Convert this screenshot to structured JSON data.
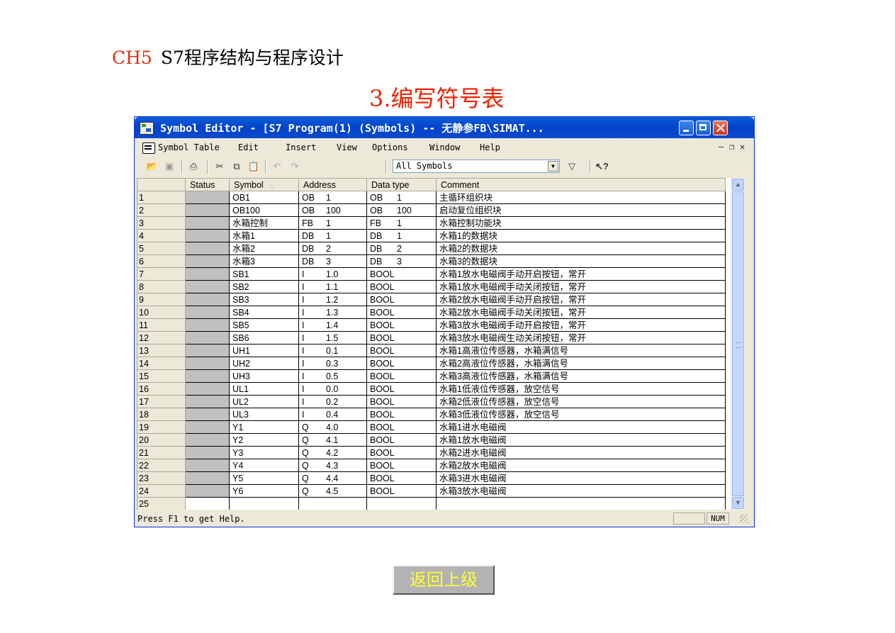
{
  "slide": {
    "chapter": "CH5",
    "title": "S7程序结构与程序设计",
    "subtitle": "3.编写符号表",
    "back_button": "返回上级"
  },
  "window": {
    "title": "Symbol Editor - [S7 Program(1) (Symbols) -- 无静参FB\\SIMAT...",
    "menu": [
      "Symbol Table",
      "Edit",
      "Insert",
      "View",
      "Options",
      "Window",
      "Help"
    ],
    "filter": "All Symbols",
    "status_text": "Press F1 to get Help.",
    "num_indicator": "NUM"
  },
  "table": {
    "headers": {
      "status": "Status",
      "symbol": "Symbol",
      "address": "Address",
      "datatype": "Data type",
      "comment": "Comment"
    },
    "rows": [
      {
        "n": "1",
        "symbol": "OB1",
        "addr_type": "OB",
        "addr_num": "1",
        "dtype": "OB",
        "dtype_num": "1",
        "comment": "主循环组织块"
      },
      {
        "n": "2",
        "symbol": "OB100",
        "addr_type": "OB",
        "addr_num": "100",
        "dtype": "OB",
        "dtype_num": "100",
        "comment": "启动复位组织块"
      },
      {
        "n": "3",
        "symbol": "水箱控制",
        "addr_type": "FB",
        "addr_num": "1",
        "dtype": "FB",
        "dtype_num": "1",
        "comment": "水箱控制功能块"
      },
      {
        "n": "4",
        "symbol": "水箱1",
        "addr_type": "DB",
        "addr_num": "1",
        "dtype": "DB",
        "dtype_num": "1",
        "comment": "水箱1的数据块"
      },
      {
        "n": "5",
        "symbol": "水箱2",
        "addr_type": "DB",
        "addr_num": "2",
        "dtype": "DB",
        "dtype_num": "2",
        "comment": "水箱2的数据块"
      },
      {
        "n": "6",
        "symbol": "水箱3",
        "addr_type": "DB",
        "addr_num": "3",
        "dtype": "DB",
        "dtype_num": "3",
        "comment": "水箱3的数据块"
      },
      {
        "n": "7",
        "symbol": "SB1",
        "addr_type": "I",
        "addr_num": "1.0",
        "dtype": "BOOL",
        "dtype_num": "",
        "comment": "水箱1放水电磁阀手动开启按钮，常开"
      },
      {
        "n": "8",
        "symbol": "SB2",
        "addr_type": "I",
        "addr_num": "1.1",
        "dtype": "BOOL",
        "dtype_num": "",
        "comment": "水箱1放水电磁阀手动关闭按钮，常开"
      },
      {
        "n": "9",
        "symbol": "SB3",
        "addr_type": "I",
        "addr_num": "1.2",
        "dtype": "BOOL",
        "dtype_num": "",
        "comment": "水箱2放水电磁阀手动开启按钮，常开"
      },
      {
        "n": "10",
        "symbol": "SB4",
        "addr_type": "I",
        "addr_num": "1.3",
        "dtype": "BOOL",
        "dtype_num": "",
        "comment": "水箱2放水电磁阀手动关闭按钮，常开"
      },
      {
        "n": "11",
        "symbol": "SB5",
        "addr_type": "I",
        "addr_num": "1.4",
        "dtype": "BOOL",
        "dtype_num": "",
        "comment": "水箱3放水电磁阀手动开启按钮，常开"
      },
      {
        "n": "12",
        "symbol": "SB6",
        "addr_type": "I",
        "addr_num": "1.5",
        "dtype": "BOOL",
        "dtype_num": "",
        "comment": "水箱3放水电磁阀生动关闭按钮，常开"
      },
      {
        "n": "13",
        "symbol": "UH1",
        "addr_type": "I",
        "addr_num": "0.1",
        "dtype": "BOOL",
        "dtype_num": "",
        "comment": "水箱1高液位传感器，水箱满信号"
      },
      {
        "n": "14",
        "symbol": "UH2",
        "addr_type": "I",
        "addr_num": "0.3",
        "dtype": "BOOL",
        "dtype_num": "",
        "comment": "水箱2高液位传感器，水箱满信号"
      },
      {
        "n": "15",
        "symbol": "UH3",
        "addr_type": "I",
        "addr_num": "0.5",
        "dtype": "BOOL",
        "dtype_num": "",
        "comment": "水箱3高液位传感器，水箱满信号"
      },
      {
        "n": "16",
        "symbol": "UL1",
        "addr_type": "I",
        "addr_num": "0.0",
        "dtype": "BOOL",
        "dtype_num": "",
        "comment": "水箱1低液位传感器，放空信号"
      },
      {
        "n": "17",
        "symbol": "UL2",
        "addr_type": "I",
        "addr_num": "0.2",
        "dtype": "BOOL",
        "dtype_num": "",
        "comment": "水箱2低液位传感器，放空信号"
      },
      {
        "n": "18",
        "symbol": "UL3",
        "addr_type": "I",
        "addr_num": "0.4",
        "dtype": "BOOL",
        "dtype_num": "",
        "comment": "水箱3低液位传感器，放空信号"
      },
      {
        "n": "19",
        "symbol": "Y1",
        "addr_type": "Q",
        "addr_num": "4.0",
        "dtype": "BOOL",
        "dtype_num": "",
        "comment": "水箱1进水电磁阀"
      },
      {
        "n": "20",
        "symbol": "Y2",
        "addr_type": "Q",
        "addr_num": "4.1",
        "dtype": "BOOL",
        "dtype_num": "",
        "comment": "水箱1放水电磁阀"
      },
      {
        "n": "21",
        "symbol": "Y3",
        "addr_type": "Q",
        "addr_num": "4.2",
        "dtype": "BOOL",
        "dtype_num": "",
        "comment": "水箱2进水电磁阀"
      },
      {
        "n": "22",
        "symbol": "Y4",
        "addr_type": "Q",
        "addr_num": "4.3",
        "dtype": "BOOL",
        "dtype_num": "",
        "comment": "水箱2放水电磁阀"
      },
      {
        "n": "23",
        "symbol": "Y5",
        "addr_type": "Q",
        "addr_num": "4.4",
        "dtype": "BOOL",
        "dtype_num": "",
        "comment": "水箱3进水电磁阀"
      },
      {
        "n": "24",
        "symbol": "Y6",
        "addr_type": "Q",
        "addr_num": "4.5",
        "dtype": "BOOL",
        "dtype_num": "",
        "comment": "水箱3放水电磁阀"
      },
      {
        "n": "25",
        "symbol": "",
        "addr_type": "",
        "addr_num": "",
        "dtype": "",
        "dtype_num": "",
        "comment": ""
      }
    ]
  },
  "colors": {
    "chapter": "#e03010",
    "subtitle": "#ee2200",
    "titlebar": "#0343c8",
    "back_button_text": "#ffff33"
  }
}
